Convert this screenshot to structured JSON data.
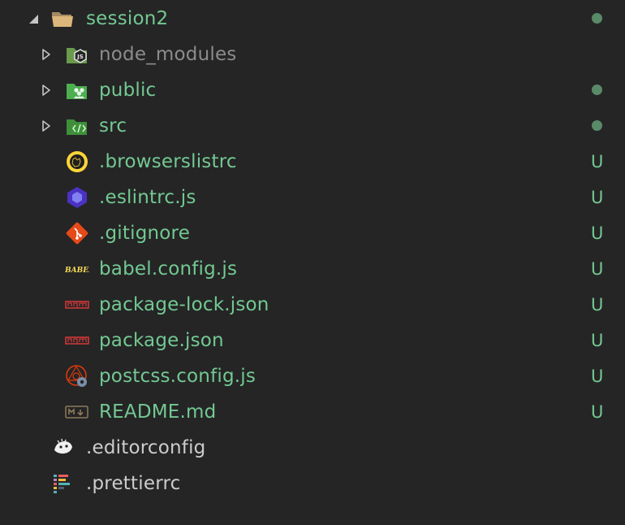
{
  "explorer": {
    "root": {
      "label": "session2",
      "expanded": true,
      "icon": "folder-open-icon",
      "status": "dot"
    },
    "items": [
      {
        "label": "node_modules",
        "type": "folder",
        "icon": "nodejs-folder-icon",
        "status": ""
      },
      {
        "label": "public",
        "type": "folder",
        "icon": "public-folder-icon",
        "status": "dot"
      },
      {
        "label": "src",
        "type": "folder",
        "icon": "src-folder-icon",
        "status": "dot"
      },
      {
        "label": ".browserslistrc",
        "type": "file",
        "icon": "browserslist-icon",
        "status": "U"
      },
      {
        "label": ".eslintrc.js",
        "type": "file",
        "icon": "eslint-icon",
        "status": "U"
      },
      {
        "label": ".gitignore",
        "type": "file",
        "icon": "git-icon",
        "status": "U"
      },
      {
        "label": "babel.config.js",
        "type": "file",
        "icon": "babel-icon",
        "status": "U"
      },
      {
        "label": "package-lock.json",
        "type": "file",
        "icon": "npm-icon",
        "status": "U"
      },
      {
        "label": "package.json",
        "type": "file",
        "icon": "npm-icon",
        "status": "U"
      },
      {
        "label": "postcss.config.js",
        "type": "file",
        "icon": "postcss-icon",
        "status": "U"
      },
      {
        "label": "README.md",
        "type": "file",
        "icon": "markdown-icon",
        "status": "U"
      }
    ],
    "outer_items": [
      {
        "label": ".editorconfig",
        "icon": "editorconfig-icon"
      },
      {
        "label": ".prettierrc",
        "icon": "prettier-icon"
      }
    ],
    "colors": {
      "background": "#252526",
      "untracked": "#73c991",
      "ignored": "#8c8c8c",
      "normal": "#cccccc",
      "dot": "#5a8a68"
    }
  }
}
